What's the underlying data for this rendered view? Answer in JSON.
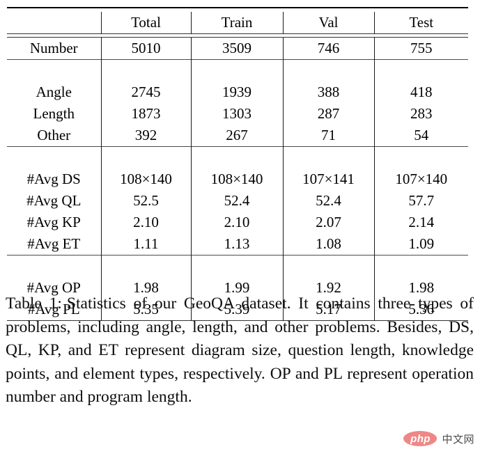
{
  "table": {
    "column_headers": [
      "",
      "Total",
      "Train",
      "Val",
      "Test"
    ],
    "groups": [
      {
        "name": "counts-total",
        "rows": [
          {
            "label": "Number",
            "values": [
              "5010",
              "3509",
              "746",
              "755"
            ]
          }
        ]
      },
      {
        "name": "problem-types",
        "rows": [
          {
            "label": "Angle",
            "values": [
              "2745",
              "1939",
              "388",
              "418"
            ]
          },
          {
            "label": "Length",
            "values": [
              "1873",
              "1303",
              "287",
              "283"
            ]
          },
          {
            "label": "Other",
            "values": [
              "392",
              "267",
              "71",
              "54"
            ]
          }
        ]
      },
      {
        "name": "averages-a",
        "rows": [
          {
            "label": "#Avg DS",
            "values": [
              "108×140",
              "108×140",
              "107×141",
              "107×140"
            ]
          },
          {
            "label": "#Avg QL",
            "values": [
              "52.5",
              "52.4",
              "52.4",
              "57.7"
            ]
          },
          {
            "label": "#Avg KP",
            "values": [
              "2.10",
              "2.10",
              "2.07",
              "2.14"
            ]
          },
          {
            "label": "#Avg ET",
            "values": [
              "1.11",
              "1.13",
              "1.08",
              "1.09"
            ]
          }
        ]
      },
      {
        "name": "averages-b",
        "rows": [
          {
            "label": "#Avg OP",
            "values": [
              "1.98",
              "1.99",
              "1.92",
              "1.98"
            ]
          },
          {
            "label": "#Avg PL",
            "values": [
              "5.35",
              "5.39",
              "5.17",
              "5.36"
            ]
          }
        ]
      }
    ]
  },
  "caption": {
    "label": "Table 1:",
    "text": "Statistics of our GeoQA dataset.  It contains three types of problems, including angle, length, and other problems.  Besides, DS, QL, KP, and ET represent diagram size, question length, knowledge points, and element types, respectively.  OP and PL represent operation number and program length."
  },
  "watermark": {
    "badge_text": "php",
    "badge_color": "#ef8787",
    "side_text": "中文网"
  }
}
